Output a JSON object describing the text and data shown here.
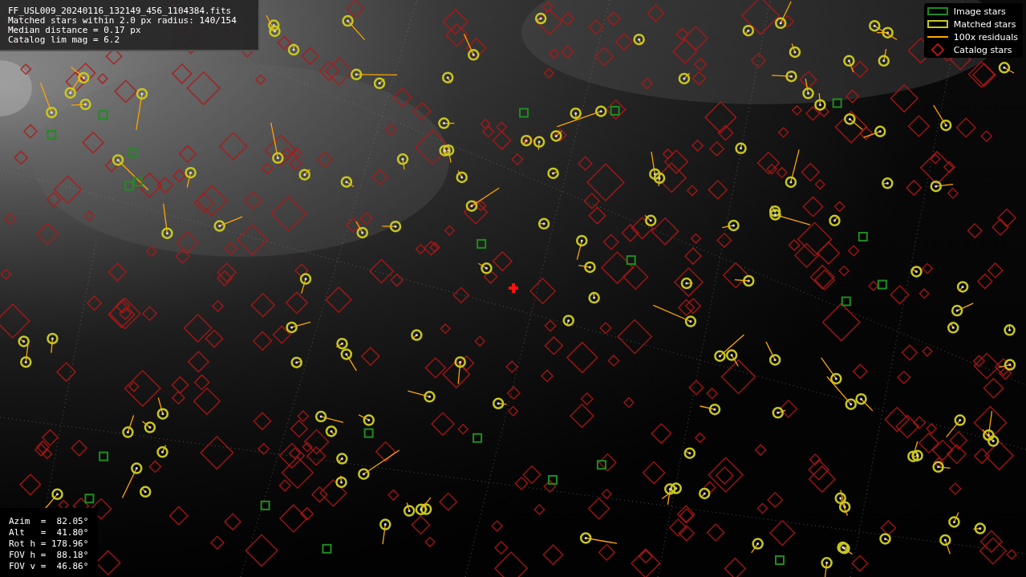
{
  "info_panel": {
    "lines": [
      "FF_USL009_20240116_132149_456_1104384.fits",
      "Matched stars within 2.0 px radius: 140/154",
      "Median distance = 0.17 px",
      "Catalog lim mag = 6.2"
    ]
  },
  "legend": {
    "items": [
      {
        "label": "Image stars",
        "color": "#1f8c1f"
      },
      {
        "kind": "matched",
        "label": "Matched stars",
        "color": "#c8c81e"
      },
      {
        "kind": "residual",
        "label": "100x residuals",
        "color": "#ffa500"
      },
      {
        "kind": "catalog",
        "label": "Catalog stars",
        "color": "#b01818"
      }
    ]
  },
  "pointing_panel": {
    "lines": [
      "Azim  =  82.05°",
      "Alt   =  41.80°",
      "Rot h = 178.96°",
      "FOV h =  88.18°",
      "FOV v =  46.86°"
    ]
  }
}
